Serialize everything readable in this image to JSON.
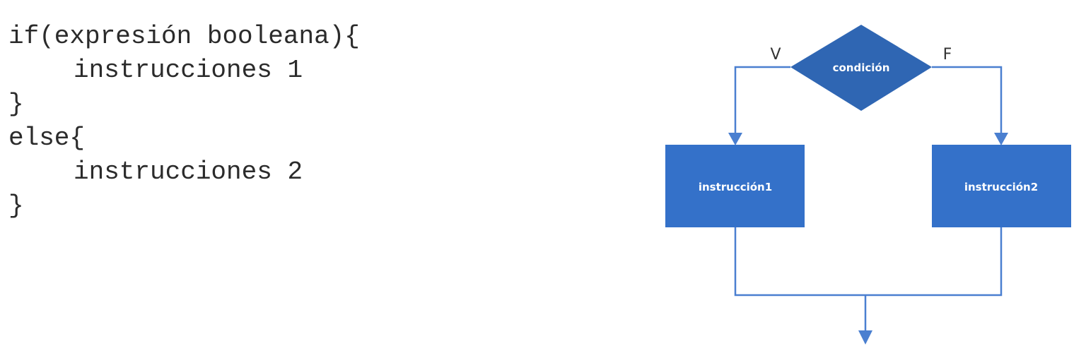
{
  "code": {
    "lines": [
      "if(expresión booleana){",
      "instrucciones 1",
      "}",
      "else{",
      "instrucciones 2",
      "}"
    ]
  },
  "flowchart": {
    "decision_label": "condición",
    "true_label": "V",
    "false_label": "F",
    "true_box_label": "instrucción1",
    "false_box_label": "instrucción2",
    "fill_color": "#3471c9",
    "decision_color": "#2f66b3",
    "line_color": "#4a7fd0"
  }
}
